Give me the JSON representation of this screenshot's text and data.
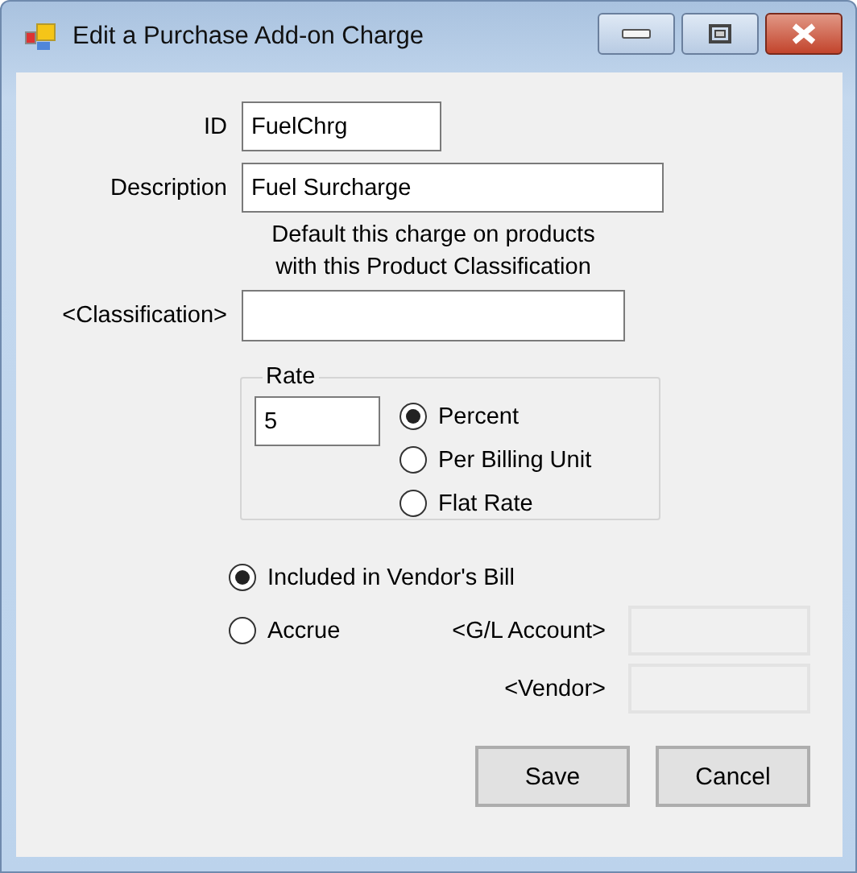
{
  "window": {
    "title": "Edit a Purchase Add-on Charge"
  },
  "id": {
    "label": "ID",
    "value": "FuelChrg"
  },
  "description": {
    "label": "Description",
    "value": "Fuel Surcharge"
  },
  "note": [
    "Default this charge on products",
    "with this Product Classification"
  ],
  "classification": {
    "label": "<Classification>"
  },
  "rate": {
    "label": "Rate",
    "value": "5",
    "options": [
      {
        "label": "Percent",
        "selected": true
      },
      {
        "label": "Per Billing Unit",
        "selected": false
      },
      {
        "label": "Flat Rate",
        "selected": false
      }
    ]
  },
  "billing": [
    {
      "label": "Included in Vendor's Bill",
      "selected": true
    },
    {
      "label": "Accrue",
      "selected": false
    }
  ],
  "gl_account": {
    "label": "<G/L Account>",
    "disabled": true
  },
  "vendor": {
    "label": "<Vendor>",
    "disabled": true
  },
  "buttons": [
    "Save",
    "Cancel"
  ]
}
